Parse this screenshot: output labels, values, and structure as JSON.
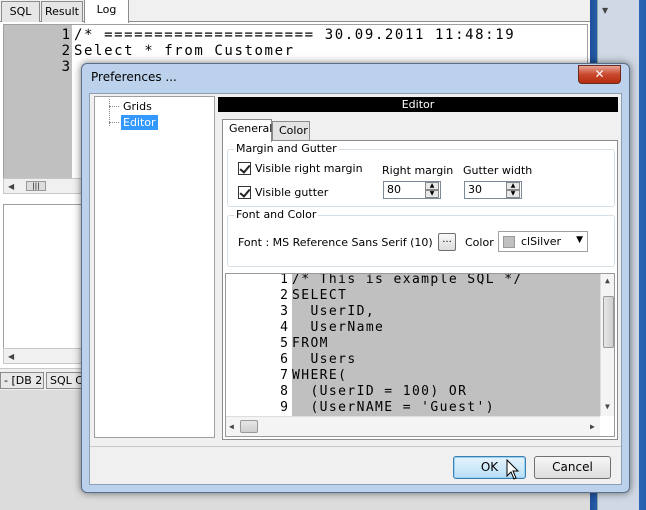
{
  "background": {
    "tabs": [
      {
        "label": "SQL",
        "active": false
      },
      {
        "label": "Result",
        "active": false
      },
      {
        "label": "Log",
        "active": true
      }
    ],
    "log_lines": [
      {
        "n": "1",
        "text": "/* ===================== 30.09.2011 11:48:19"
      },
      {
        "n": "2",
        "text": "Select * from Customer"
      },
      {
        "n": "3",
        "text": ""
      }
    ],
    "status_tabs": [
      "- [DB 2]",
      "SQL C"
    ]
  },
  "dialog": {
    "title": "Preferences ...",
    "close_glyph": "✕",
    "tree": [
      "Grids",
      "Editor"
    ],
    "selected_tree": "Editor",
    "header": "Editor",
    "tabs": [
      {
        "label": "General",
        "active": true
      },
      {
        "label": "Color",
        "active": false
      }
    ],
    "margin_group": {
      "legend": "Margin and Gutter",
      "visible_right_margin": {
        "label": "Visible right margin",
        "checked": true
      },
      "visible_gutter": {
        "label": "Visible gutter",
        "checked": true
      },
      "right_margin": {
        "label": "Right margin",
        "value": "80"
      },
      "gutter_width": {
        "label": "Gutter width",
        "value": "30"
      }
    },
    "font_group": {
      "legend": "Font and Color",
      "font_text": "Font :  MS Reference Sans Serif (10)",
      "browse_label": "...",
      "color_label": "Color :",
      "color_value": "clSilver",
      "color_hex": "#c0c0c0"
    },
    "preview_lines": [
      {
        "n": "1",
        "text": "/* This is example SQL */"
      },
      {
        "n": "2",
        "text": "SELECT"
      },
      {
        "n": "3",
        "text": "  UserID,"
      },
      {
        "n": "4",
        "text": "  UserName"
      },
      {
        "n": "5",
        "text": "FROM"
      },
      {
        "n": "6",
        "text": "  Users"
      },
      {
        "n": "7",
        "text": "WHERE("
      },
      {
        "n": "8",
        "text": "  (UserID = 100) OR"
      },
      {
        "n": "9",
        "text": "  (UserNAME = 'Guest')"
      }
    ],
    "ok_label": "OK",
    "cancel_label": "Cancel"
  }
}
